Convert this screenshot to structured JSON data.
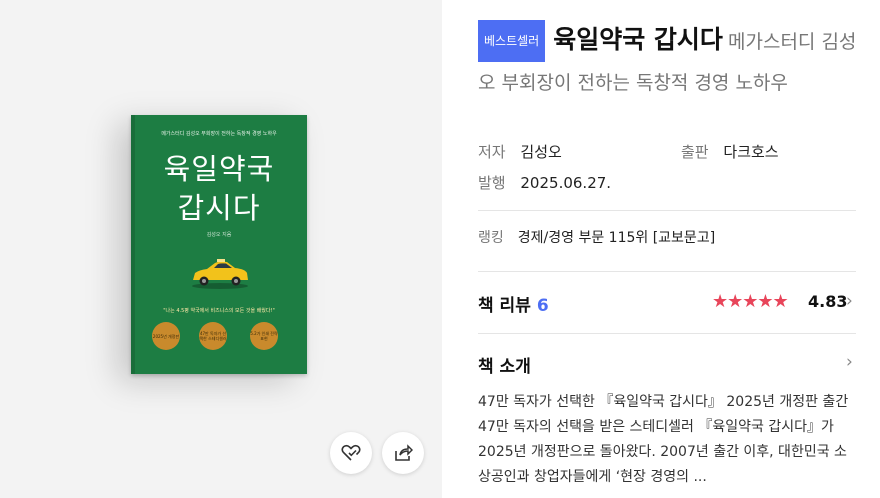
{
  "book_cover": {
    "tagline": "메가스터디 김성오 부회장이 전하는 독창적 경영 노하우",
    "title_line1": "육일약국",
    "title_line2": "갑시다",
    "author": "김성오 지음",
    "quote": "\"나는 4.5평 약국에서 비즈니스의 모든 것을 배웠다!\"",
    "badges": [
      "2025년 개정판",
      "47만 독자가 선택한 스테디셀러",
      "5.2가 인쇄 전략 표현"
    ]
  },
  "actions": {
    "wishlist_icon": "heart-check-icon",
    "share_icon": "share-icon"
  },
  "product": {
    "badge": "베스트셀러",
    "title": "육일약국 갑시다",
    "subtitle": "메가스터디 김성오 부회장이 전하는 독창적 경영 노하우",
    "author_label": "저자",
    "author": "김성오",
    "publisher_label": "출판",
    "publisher": "다크호스",
    "date_label": "발행",
    "date": "2025.06.27.",
    "ranking_label": "랭킹",
    "ranking": "경제/경영 부문 115위 [교보문고]"
  },
  "review": {
    "label": "책 리뷰",
    "count": "6",
    "stars": "★★★★★",
    "score": "4.83",
    "chevron": "›"
  },
  "intro": {
    "label": "책 소개",
    "chevron": "›",
    "text": "47만 독자가 선택한 『육일약국 갑시다』 2025년 개정판 출간 47만 독자의 선택을 받은 스테디셀러 『육일약국 갑시다』가 2025년 개정판으로 돌아왔다. 2007년 출간 이후, 대한민국 소상공인과 창업자들에게 ‘현장 경영의 ..."
  },
  "colors": {
    "cover": "#1d7d43",
    "accent": "#4d6ef3",
    "star": "#e8455a"
  }
}
